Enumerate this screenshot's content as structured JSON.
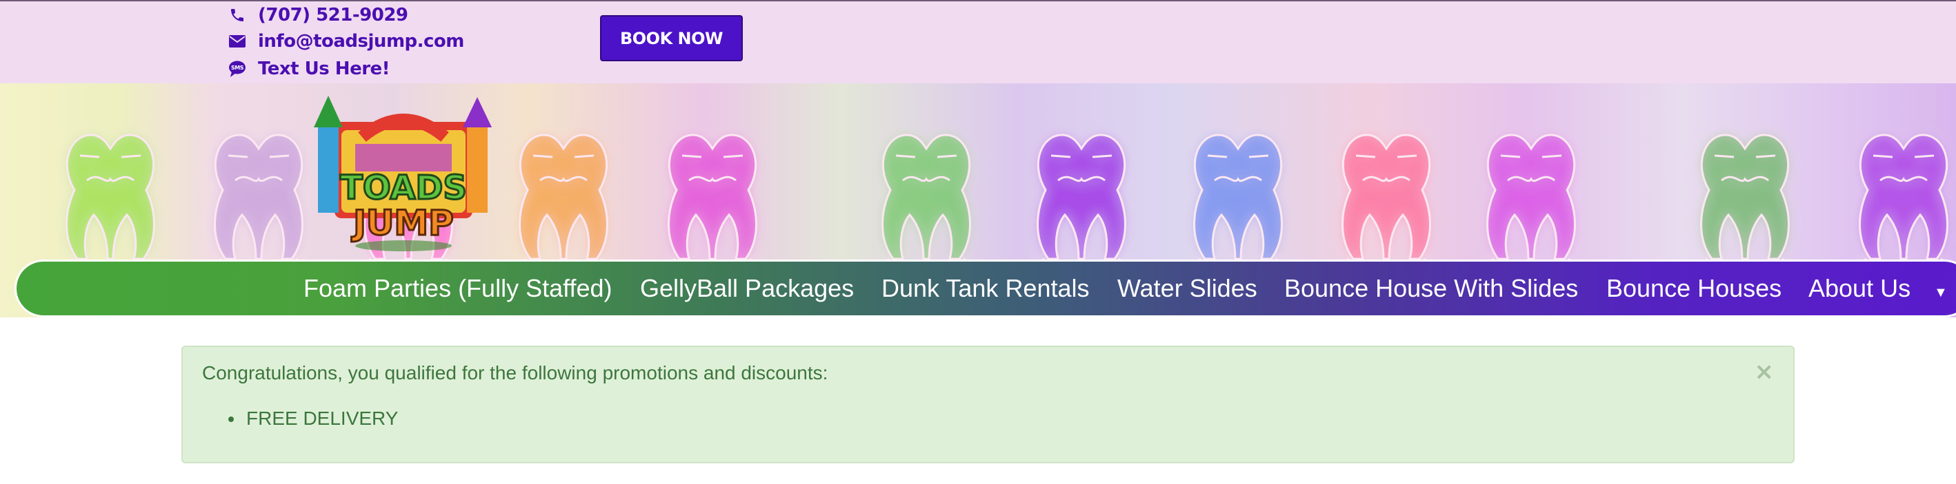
{
  "contact": {
    "phone": "(707) 521-9029",
    "email": "info@toadsjump.com",
    "text": "Text Us Here!",
    "icons": [
      "phone-icon",
      "envelope-icon",
      "sms-chat-icon"
    ]
  },
  "header": {
    "book_button_label": "BOOK NOW",
    "logo_text_top": "TOADS",
    "logo_text_bottom": "JUMP"
  },
  "nav": {
    "items": [
      {
        "label": "Foam Parties (Fully Staffed)"
      },
      {
        "label": "GellyBall Packages"
      },
      {
        "label": "Dunk Tank Rentals"
      },
      {
        "label": "Water Slides"
      },
      {
        "label": "Bounce House With Slides"
      },
      {
        "label": "Bounce Houses"
      },
      {
        "label": "About Us"
      }
    ],
    "caret": "▼"
  },
  "alert": {
    "message": "Congratulations, you qualified for the following promotions and discounts:",
    "items": [
      "FREE DELIVERY"
    ],
    "close_glyph": "×"
  },
  "colors": {
    "brand_purple": "#4c12c8",
    "topbar_bg": "#f1dbf1",
    "alert_bg": "#dff0d8",
    "alert_text": "#3c763d",
    "nav_start": "#45a53a",
    "nav_end": "#5a1bcc"
  }
}
